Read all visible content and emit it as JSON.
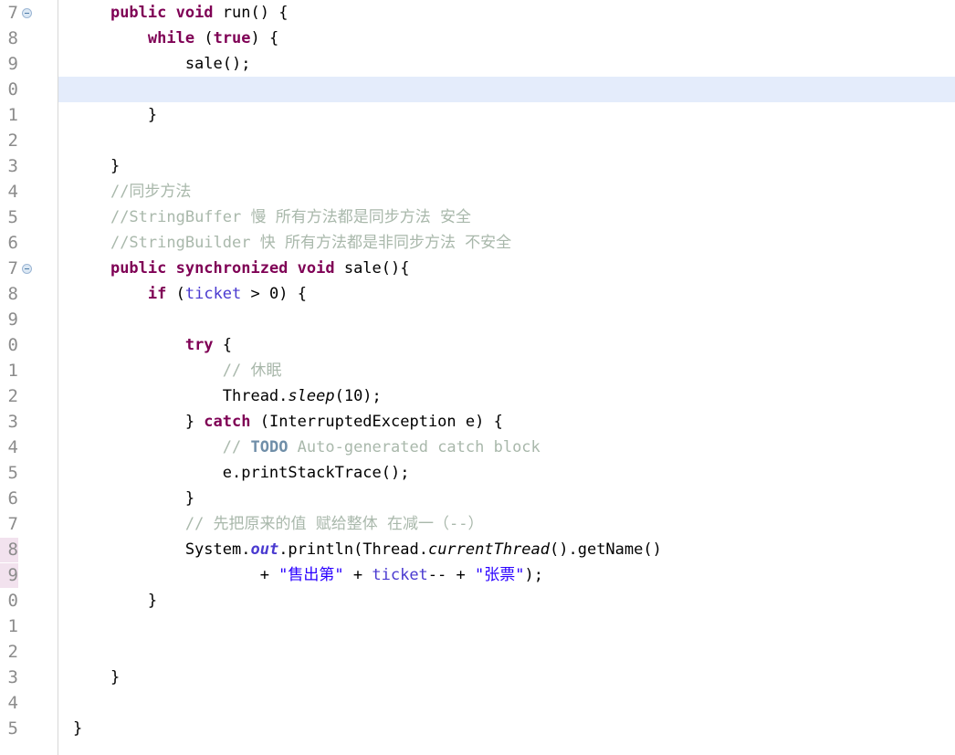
{
  "editor": {
    "language": "Java",
    "font_size_px": 17,
    "line_height_px": 28,
    "colors": {
      "background": "#ffffff",
      "keyword": "#7f0055",
      "string": "#2a00ff",
      "comment": "#a9b8ab",
      "todo_tag": "#6f8ea8",
      "field": "#4a3ad0",
      "plain_text": "#000000",
      "current_line_highlight": "#e4ecfb",
      "gutter_number": "#8c8c8c",
      "gutter_marker": "#f2e2ee",
      "gutter_border": "#d7d7d7",
      "fold_icon_fill": "#dce8f4",
      "fold_icon_border": "#9cb6d4"
    },
    "gutter": {
      "line_numbers": [
        "7",
        "8",
        "9",
        "0",
        "1",
        "2",
        "3",
        "4",
        "5",
        "6",
        "7",
        "8",
        "9",
        "0",
        "1",
        "2",
        "3",
        "4",
        "5",
        "6",
        "7",
        "8",
        "9",
        "0",
        "1",
        "2",
        "3",
        "4",
        "5"
      ],
      "fold_marker_rows": [
        0,
        10
      ],
      "change_marker_rows": [
        21,
        22
      ],
      "current_line_row": 3
    },
    "lines": [
      {
        "n": 0,
        "tokens": [
          {
            "t": "    ",
            "c": "pln"
          },
          {
            "t": "public void",
            "c": "kw"
          },
          {
            "t": " run() {",
            "c": "pln"
          }
        ]
      },
      {
        "n": 1,
        "tokens": [
          {
            "t": "        ",
            "c": "pln"
          },
          {
            "t": "while",
            "c": "kw"
          },
          {
            "t": " (",
            "c": "pln"
          },
          {
            "t": "true",
            "c": "kw"
          },
          {
            "t": ") {",
            "c": "pln"
          }
        ]
      },
      {
        "n": 2,
        "tokens": [
          {
            "t": "            sale();",
            "c": "pln"
          }
        ]
      },
      {
        "n": 3,
        "tokens": [
          {
            "t": "",
            "c": "pln"
          }
        ]
      },
      {
        "n": 4,
        "tokens": [
          {
            "t": "        }",
            "c": "pln"
          }
        ]
      },
      {
        "n": 5,
        "tokens": [
          {
            "t": "",
            "c": "pln"
          }
        ]
      },
      {
        "n": 6,
        "tokens": [
          {
            "t": "    }",
            "c": "pln"
          }
        ]
      },
      {
        "n": 7,
        "tokens": [
          {
            "t": "    ",
            "c": "pln"
          },
          {
            "t": "//同步方法",
            "c": "cmt"
          }
        ]
      },
      {
        "n": 8,
        "tokens": [
          {
            "t": "    ",
            "c": "pln"
          },
          {
            "t": "//StringBuffer 慢 所有方法都是同步方法 安全",
            "c": "cmt"
          }
        ]
      },
      {
        "n": 9,
        "tokens": [
          {
            "t": "    ",
            "c": "pln"
          },
          {
            "t": "//StringBuilder 快 所有方法都是非同步方法 不安全",
            "c": "cmt"
          }
        ]
      },
      {
        "n": 10,
        "tokens": [
          {
            "t": "    ",
            "c": "pln"
          },
          {
            "t": "public synchronized void",
            "c": "kw"
          },
          {
            "t": " sale(){",
            "c": "pln"
          }
        ]
      },
      {
        "n": 11,
        "tokens": [
          {
            "t": "        ",
            "c": "pln"
          },
          {
            "t": "if",
            "c": "kw"
          },
          {
            "t": " (",
            "c": "pln"
          },
          {
            "t": "ticket",
            "c": "fld"
          },
          {
            "t": " > 0) {",
            "c": "pln"
          }
        ]
      },
      {
        "n": 12,
        "tokens": [
          {
            "t": "",
            "c": "pln"
          }
        ]
      },
      {
        "n": 13,
        "tokens": [
          {
            "t": "            ",
            "c": "pln"
          },
          {
            "t": "try",
            "c": "kw"
          },
          {
            "t": " {",
            "c": "pln"
          }
        ]
      },
      {
        "n": 14,
        "tokens": [
          {
            "t": "                ",
            "c": "pln"
          },
          {
            "t": "// 休眠",
            "c": "cmt"
          }
        ]
      },
      {
        "n": 15,
        "tokens": [
          {
            "t": "                Thread.",
            "c": "pln"
          },
          {
            "t": "sleep",
            "c": "stat"
          },
          {
            "t": "(10);",
            "c": "pln"
          }
        ]
      },
      {
        "n": 16,
        "tokens": [
          {
            "t": "            } ",
            "c": "pln"
          },
          {
            "t": "catch",
            "c": "kw"
          },
          {
            "t": " (InterruptedException e) {",
            "c": "pln"
          }
        ]
      },
      {
        "n": 17,
        "tokens": [
          {
            "t": "                ",
            "c": "pln"
          },
          {
            "t": "// ",
            "c": "cmt"
          },
          {
            "t": "TODO",
            "c": "todo"
          },
          {
            "t": " Auto-generated catch block",
            "c": "cmt"
          }
        ]
      },
      {
        "n": 18,
        "tokens": [
          {
            "t": "                e.printStackTrace();",
            "c": "pln"
          }
        ]
      },
      {
        "n": 19,
        "tokens": [
          {
            "t": "            }",
            "c": "pln"
          }
        ]
      },
      {
        "n": 20,
        "tokens": [
          {
            "t": "            ",
            "c": "pln"
          },
          {
            "t": "// 先把原来的值 赋给整体 在减一（--）",
            "c": "cmt"
          }
        ]
      },
      {
        "n": 21,
        "tokens": [
          {
            "t": "            System.",
            "c": "pln"
          },
          {
            "t": "out",
            "c": "fldb"
          },
          {
            "t": ".println(Thread.",
            "c": "pln"
          },
          {
            "t": "currentThread",
            "c": "stat"
          },
          {
            "t": "().getName()",
            "c": "pln"
          }
        ]
      },
      {
        "n": 22,
        "tokens": [
          {
            "t": "                    + ",
            "c": "pln"
          },
          {
            "t": "\"售出第\"",
            "c": "str"
          },
          {
            "t": " + ",
            "c": "pln"
          },
          {
            "t": "ticket",
            "c": "fld"
          },
          {
            "t": "-- + ",
            "c": "pln"
          },
          {
            "t": "\"张票\"",
            "c": "str"
          },
          {
            "t": ");",
            "c": "pln"
          }
        ]
      },
      {
        "n": 23,
        "tokens": [
          {
            "t": "        }",
            "c": "pln"
          }
        ]
      },
      {
        "n": 24,
        "tokens": [
          {
            "t": "",
            "c": "pln"
          }
        ]
      },
      {
        "n": 25,
        "tokens": [
          {
            "t": "",
            "c": "pln"
          }
        ]
      },
      {
        "n": 26,
        "tokens": [
          {
            "t": "    }",
            "c": "pln"
          }
        ]
      },
      {
        "n": 27,
        "tokens": [
          {
            "t": "",
            "c": "pln"
          }
        ]
      },
      {
        "n": 28,
        "tokens": [
          {
            "t": "}",
            "c": "pln"
          }
        ]
      }
    ]
  }
}
